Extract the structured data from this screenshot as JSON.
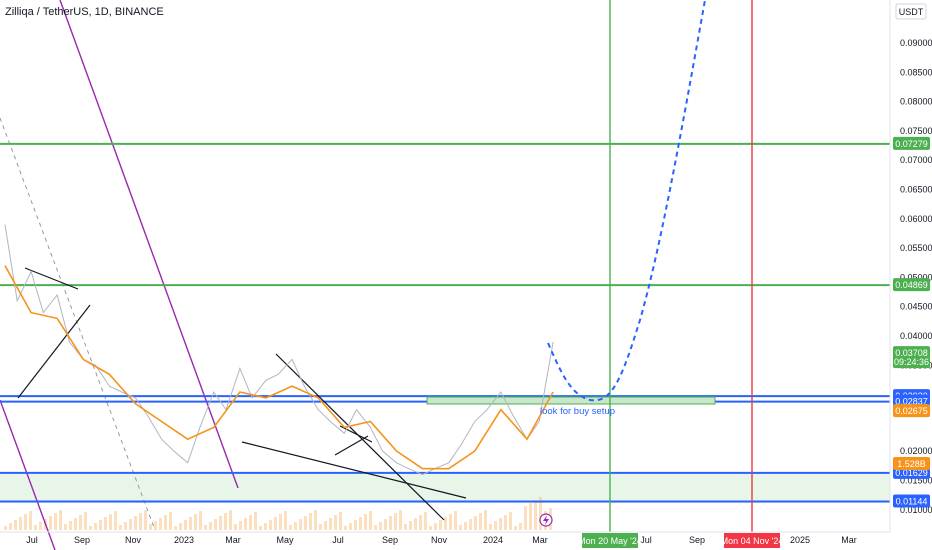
{
  "header": {
    "title": "Zilliqa / TetherUS, 1D, BINANCE",
    "currency": "USDT"
  },
  "chart_data": {
    "type": "line",
    "title": "Zilliqa / TetherUS, 1D, BINANCE",
    "y_unit": "USDT",
    "ylim": [
      0.0085,
      0.101
    ],
    "y_ticks": [
      "0.09000",
      "0.08500",
      "0.08000",
      "0.07500",
      "0.07000",
      "0.06500",
      "0.06000",
      "0.05500",
      "0.05000",
      "0.04500",
      "0.04000",
      "0.03500",
      "0.02000",
      "0.01500",
      "0.01000"
    ],
    "x_ticks": [
      "Jul",
      "Sep",
      "Nov",
      "2023",
      "Mar",
      "May",
      "Jul",
      "Sep",
      "Nov",
      "2024",
      "Mar",
      "Jul",
      "Sep",
      "2025",
      "Mar"
    ],
    "price_series": {
      "name": "price",
      "color": "#b2b5be",
      "x": [
        "2022-06",
        "2022-06-15",
        "2022-07",
        "2022-07-15",
        "2022-08",
        "2022-08-15",
        "2022-09",
        "2022-09-15",
        "2022-10",
        "2022-10-15",
        "2022-11",
        "2022-11-15",
        "2022-12",
        "2022-12-15",
        "2023-01",
        "2023-01-15",
        "2023-02",
        "2023-02-15",
        "2023-03",
        "2023-03-15",
        "2023-04",
        "2023-04-15",
        "2023-05",
        "2023-05-15",
        "2023-06",
        "2023-06-15",
        "2023-07",
        "2023-07-15",
        "2023-08",
        "2023-08-15",
        "2023-09",
        "2023-09-15",
        "2023-10",
        "2023-10-15",
        "2023-11",
        "2023-11-15",
        "2023-12",
        "2023-12-15",
        "2024-01",
        "2024-01-15",
        "2024-02",
        "2024-02-15",
        "2024-03"
      ],
      "y": [
        0.059,
        0.046,
        0.051,
        0.044,
        0.047,
        0.039,
        0.036,
        0.035,
        0.031,
        0.03,
        0.029,
        0.026,
        0.022,
        0.02,
        0.018,
        0.024,
        0.03,
        0.027,
        0.034,
        0.029,
        0.032,
        0.033,
        0.036,
        0.031,
        0.027,
        0.025,
        0.023,
        0.027,
        0.024,
        0.02,
        0.018,
        0.017,
        0.016,
        0.017,
        0.018,
        0.021,
        0.025,
        0.027,
        0.03,
        0.026,
        0.022,
        0.025,
        0.039
      ]
    },
    "ma_series": {
      "name": "moving average",
      "color": "#f7931a",
      "x": [
        "2022-06",
        "2022-07",
        "2022-08",
        "2022-09",
        "2022-10",
        "2022-11",
        "2022-12",
        "2023-01",
        "2023-02",
        "2023-03",
        "2023-04",
        "2023-05",
        "2023-06",
        "2023-07",
        "2023-08",
        "2023-09",
        "2023-10",
        "2023-11",
        "2023-12",
        "2024-01",
        "2024-02",
        "2024-03"
      ],
      "y": [
        0.052,
        0.044,
        0.043,
        0.036,
        0.033,
        0.028,
        0.025,
        0.022,
        0.024,
        0.03,
        0.029,
        0.031,
        0.029,
        0.024,
        0.025,
        0.02,
        0.017,
        0.017,
        0.02,
        0.027,
        0.022,
        0.03
      ]
    },
    "horizontal_levels": [
      {
        "price": 0.07279,
        "label": "0.07279",
        "color": "#4caf50"
      },
      {
        "price": 0.04869,
        "label": "0.04869",
        "color": "#4caf50"
      },
      {
        "price": 0.0293,
        "label": "0.02930",
        "color": "#2962ff"
      },
      {
        "price": 0.02837,
        "label": "0.02837",
        "color": "#2962ff"
      },
      {
        "price": 0.01629,
        "label": "0.01629",
        "color": "#2962ff"
      },
      {
        "price": 0.01144,
        "label": "0.01144",
        "color": "#2962ff"
      }
    ],
    "price_tags": [
      {
        "price": 0.03708,
        "label": "0.03708",
        "sub": "09:24:36",
        "color": "#4caf50"
      },
      {
        "price": 0.02675,
        "label": "0.02675",
        "color": "#f7931a"
      },
      {
        "price": 0.0178,
        "label": "1.528B",
        "color": "#f7931a"
      }
    ],
    "vertical_markers": [
      {
        "date": "Mon 20 May '24",
        "color": "#4caf50"
      },
      {
        "date": "Mon 04 Nov '24",
        "color": "#f23645"
      }
    ],
    "buy_zone": {
      "from": "2024-01",
      "to": "2024-09",
      "price": 0.0293
    },
    "annotation": "look for buy setup",
    "projection": {
      "name": "projected path",
      "color": "#2962ff",
      "style": "dashed"
    },
    "support_zone": {
      "low": 0.0117,
      "high": 0.0163,
      "color": "#e8f5e9"
    }
  }
}
